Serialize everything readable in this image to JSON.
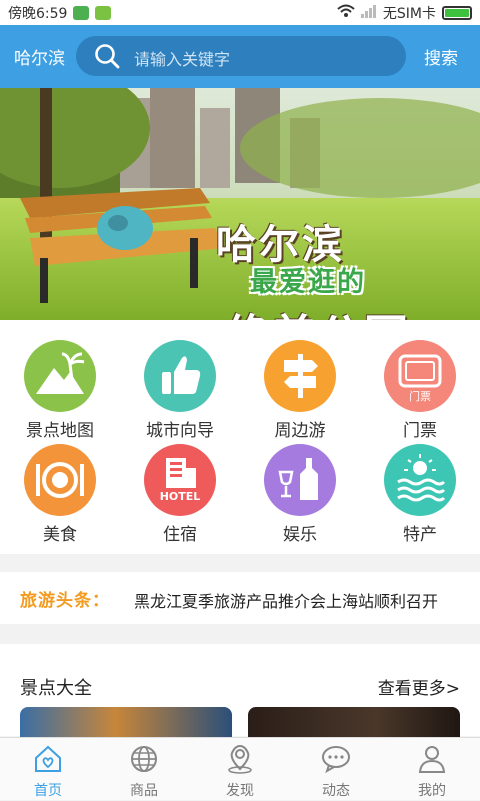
{
  "status_bar": {
    "time": "傍晚6:59",
    "carrier": "无SIM卡"
  },
  "header": {
    "city": "哈尔滨",
    "search_placeholder": "请输入关键字",
    "search_button": "搜索"
  },
  "banner": {
    "line1": "哈尔滨",
    "line2": "最爱逛的",
    "line3": "绝美公园"
  },
  "categories": [
    {
      "label": "景点地图",
      "icon": "mountain-palm-icon",
      "color": "#8bc34a"
    },
    {
      "label": "城市向导",
      "icon": "thumbs-up-icon",
      "color": "#4cc4b4"
    },
    {
      "label": "周边游",
      "icon": "signpost-icon",
      "color": "#f7a131"
    },
    {
      "label": "门票",
      "icon": "ticket-icon",
      "color": "#f4877a",
      "badge": "门票"
    },
    {
      "label": "美食",
      "icon": "dining-plate-icon",
      "color": "#f4943a"
    },
    {
      "label": "住宿",
      "icon": "hotel-icon",
      "color": "#ef5a5a",
      "badge": "HOTEL"
    },
    {
      "label": "娱乐",
      "icon": "wine-bottle-icon",
      "color": "#a57be0"
    },
    {
      "label": "特产",
      "icon": "sun-waves-icon",
      "color": "#3ec6b4"
    }
  ],
  "news": {
    "tag": "旅游头条：",
    "headline": "黑龙江夏季旅游产品推介会上海站顺利召开"
  },
  "attractions": {
    "title": "景点大全",
    "more": "查看更多>"
  },
  "tabs": [
    {
      "label": "首页",
      "icon": "home-icon",
      "active": true
    },
    {
      "label": "商品",
      "icon": "globe-icon",
      "active": false
    },
    {
      "label": "发现",
      "icon": "location-pin-icon",
      "active": false
    },
    {
      "label": "动态",
      "icon": "chat-bubble-icon",
      "active": false
    },
    {
      "label": "我的",
      "icon": "person-icon",
      "active": false
    }
  ],
  "colors": {
    "accent": "#3ea0e3",
    "search_bg": "#2d7fbd",
    "news_tag": "#f39b1f"
  }
}
